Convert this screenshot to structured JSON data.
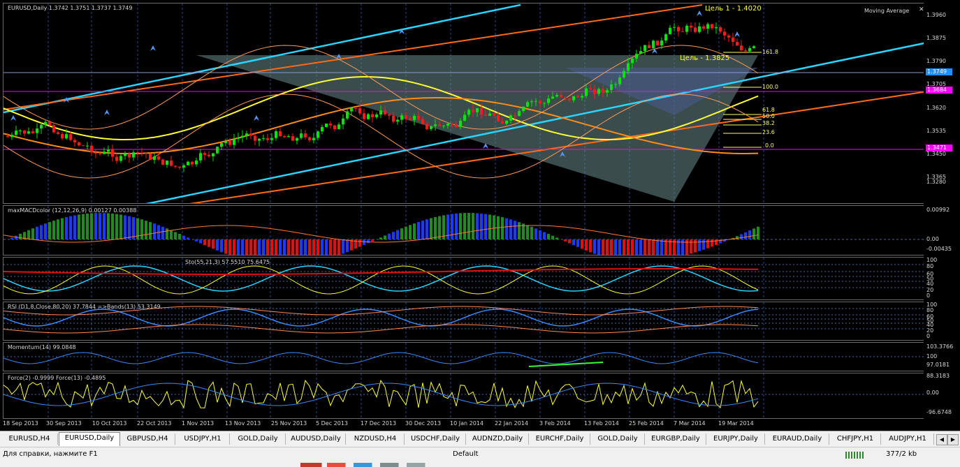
{
  "chart": {
    "header": "EURUSD,Daily  1.3742 1.3751 1.3737 1.3749",
    "indicator_name": "Moving Average",
    "price_axis": [
      "1.3960",
      "1.3875",
      "1.3790",
      "1.3705",
      "1.3620",
      "1.3535",
      "1.3450",
      "1.3365",
      "1.3280"
    ],
    "price_tags": {
      "current": "1.3749",
      "upper": "1.3684",
      "lower": "1.3471"
    },
    "target_label": "Цель 1 - 1.4020",
    "target2_label": "Цель - 1.3825",
    "fib_levels": [
      "161.8",
      "100.0",
      "61.8",
      "50.0",
      "38.2",
      "23.6",
      "0.0"
    ],
    "colors": {
      "candle_up": "#00e600",
      "candle_down": "#ff1a1a",
      "channel": "#2ad4ff",
      "orange": "#ff6a1a",
      "yellow": "#ffff33",
      "magenta": "#ff00ff",
      "triangle": "#6b8a8a"
    }
  },
  "macd": {
    "label": "maxMACDcolor (12,12,26,9) 0.00127 0.00388",
    "axis": [
      "0.00992",
      "0.00",
      "-0.00435"
    ]
  },
  "stoch": {
    "label": "Sto(55,21,3) 57.5510 75.6475",
    "axis": [
      "100",
      "80",
      "60",
      "50",
      "40",
      "20",
      "0"
    ]
  },
  "rsi": {
    "label": "RSI (D1,8,Close,80,20) 37.7844  =>Bands(13) 53.3149",
    "axis": [
      "100",
      "80",
      "60",
      "50",
      "40",
      "20",
      "0"
    ]
  },
  "momentum": {
    "label": "Momentum(14) 99.0848",
    "axis": [
      "103.3766",
      "100",
      "97.0181"
    ]
  },
  "force": {
    "label": "Force(2) -0.9999  Force(13) -0.4895",
    "axis": [
      "88.3183",
      "0.00",
      "-96.6748"
    ]
  },
  "dates": [
    "18 Sep 2013",
    "30 Sep 2013",
    "10 Oct 2013",
    "22 Oct 2013",
    "1 Nov 2013",
    "13 Nov 2013",
    "25 Nov 2013",
    "5 Dec 2013",
    "17 Dec 2013",
    "30 Dec 2013",
    "10 Jan 2014",
    "22 Jan 2014",
    "3 Feb 2014",
    "13 Feb 2014",
    "25 Feb 2014",
    "7 Mar 2014",
    "19 Mar 2014"
  ],
  "tabs": [
    "EURUSD,H4",
    "EURUSD,Daily",
    "GBPUSD,H4",
    "USDJPY,H1",
    "GOLD,Daily",
    "AUDUSD,Daily",
    "NZDUSD,H4",
    "USDCHF,Daily",
    "AUDNZD,Daily",
    "EURCHF,Daily",
    "GOLD,Daily",
    "EURGBP,Daily",
    "EURJPY,Daily",
    "EURAUD,Daily",
    "CHFJPY,H1",
    "AUDJPY,H1"
  ],
  "status": {
    "help": "Для справки, нажмите F1",
    "profile": "Default",
    "traffic": "377/2 kb"
  }
}
